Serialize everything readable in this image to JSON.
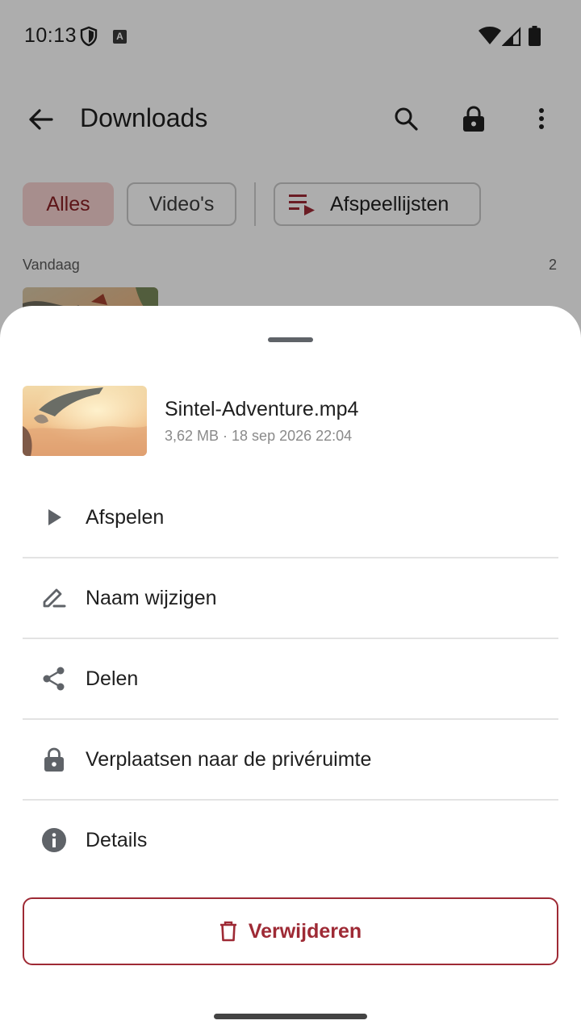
{
  "status_bar": {
    "time": "10:13",
    "notification_icon": "A"
  },
  "app_bar": {
    "title": "Downloads"
  },
  "filters": {
    "all_label": "Alles",
    "videos_label": "Video's",
    "playlists_label": "Afspeellijsten"
  },
  "list": {
    "section_label": "Vandaag",
    "section_count": "2"
  },
  "sheet": {
    "file_name": "Sintel-Adventure.mp4",
    "file_meta": "3,62 MB · 18 sep 2026 22:04",
    "actions": [
      {
        "label": "Afspelen",
        "icon": "play-icon"
      },
      {
        "label": "Naam wijzigen",
        "icon": "rename-icon"
      },
      {
        "label": "Delen",
        "icon": "share-icon"
      },
      {
        "label": "Verplaatsen naar de privéruimte",
        "icon": "lock-icon"
      },
      {
        "label": "Details",
        "icon": "info-icon"
      }
    ],
    "delete_label": "Verwijderen"
  },
  "colors": {
    "accent": "#9e2a35",
    "chip_selected_bg": "#f6d2d0",
    "icon_gray": "#5f6368"
  }
}
